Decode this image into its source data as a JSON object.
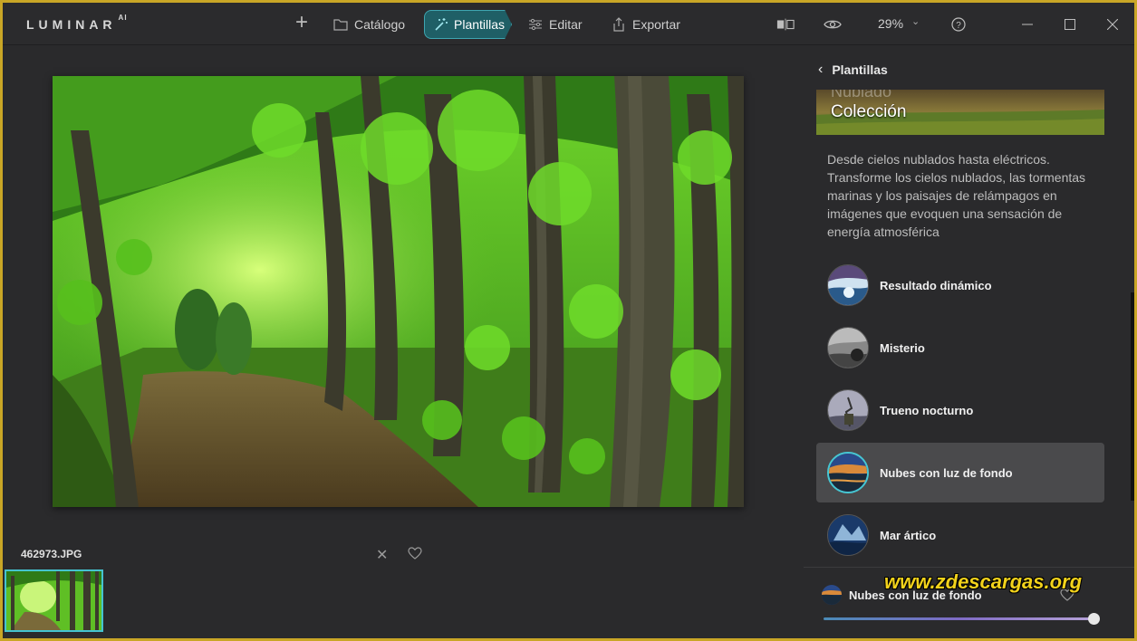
{
  "app": {
    "logo": "LUMINAR",
    "logo_suffix": "AI"
  },
  "toolbar": {
    "catalog_label": "Catálogo",
    "templates_label": "Plantillas",
    "edit_label": "Editar",
    "export_label": "Exportar",
    "zoom_value": "29%"
  },
  "canvas": {
    "filename": "462973.JPG"
  },
  "panel": {
    "back_label": "Plantillas",
    "banner_ghost": "Nublado",
    "banner_title": "Colección",
    "description": "Desde cielos nublados hasta eléctricos. Transforme los cielos nublados, las tormentas marinas y los paisajes de relámpagos en imágenes que evoquen una sensación de energía atmosférica",
    "presets": [
      {
        "label": "Resultado dinámico",
        "selected": false
      },
      {
        "label": "Misterio",
        "selected": false
      },
      {
        "label": "Trueno nocturno",
        "selected": false
      },
      {
        "label": "Nubes con luz de fondo",
        "selected": true
      },
      {
        "label": "Mar ártico",
        "selected": false
      }
    ],
    "applied_label": "Nubes con luz de fondo",
    "amount": 1.0
  },
  "watermark": "www.zdescargas.org",
  "colors": {
    "accent": "#46c6d3",
    "active_tab_bg": "#1f5f66",
    "panel_bg": "#2a2a2c"
  }
}
